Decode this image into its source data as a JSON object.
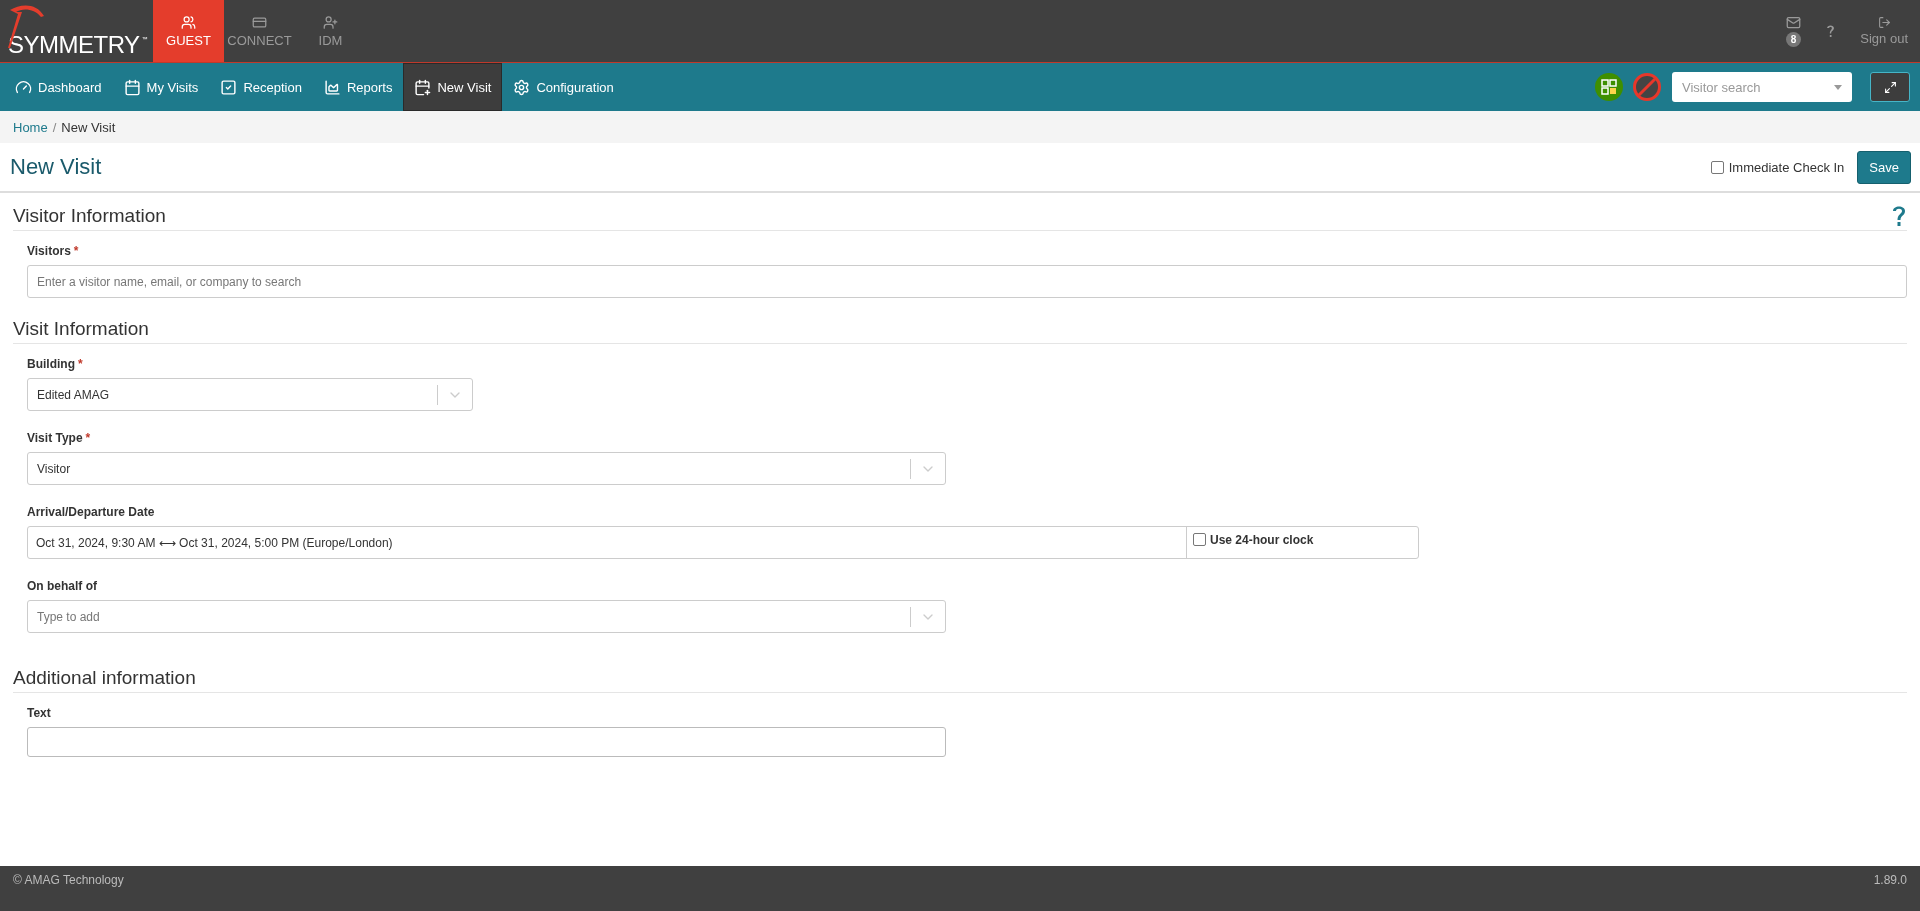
{
  "brand": {
    "name": "SYMMETRY",
    "mark": "™"
  },
  "apps": [
    {
      "label": "GUEST",
      "selected": true
    },
    {
      "label": "CONNECT",
      "selected": false
    },
    {
      "label": "IDM",
      "selected": false
    }
  ],
  "header_right": {
    "messages_badge": "8",
    "sign_out": "Sign out"
  },
  "nav": [
    {
      "label": "Dashboard",
      "selected": false
    },
    {
      "label": "My Visits",
      "selected": false
    },
    {
      "label": "Reception",
      "selected": false
    },
    {
      "label": "Reports",
      "selected": false
    },
    {
      "label": "New Visit",
      "selected": true
    },
    {
      "label": "Configuration",
      "selected": false
    }
  ],
  "visitor_search": {
    "placeholder": "Visitor search"
  },
  "breadcrumb": {
    "items": [
      "Home",
      "New Visit"
    ],
    "separator": "/"
  },
  "page_title": "New Visit",
  "immediate_check_in": {
    "label": "Immediate Check In",
    "checked": false
  },
  "save_button": "Save",
  "sections": [
    {
      "title": "Visitor Information",
      "help": true,
      "fields": [
        {
          "label": "Visitors",
          "required_mark": "*",
          "kind": "search",
          "placeholder": "Enter a visitor name, email, or company to search"
        }
      ]
    },
    {
      "title": "Visit Information",
      "fields": [
        {
          "label": "Building",
          "required_mark": "*",
          "kind": "select",
          "value": "Edited AMAG"
        },
        {
          "label": "Visit Type",
          "required_mark": "*",
          "kind": "select",
          "value": "Visitor"
        },
        {
          "label": "Arrival/Departure Date",
          "kind": "daterange",
          "start": "Oct 31, 2024, 9:30 AM",
          "arrow": "⟷",
          "end": "Oct 31, 2024, 5:00 PM (Europe/London)",
          "clock_label": "Use 24-hour clock",
          "clock_checked": false
        },
        {
          "label": "On behalf of",
          "kind": "select",
          "placeholder": "Type to add"
        }
      ]
    },
    {
      "title": "Additional information",
      "fields": [
        {
          "label": "Text",
          "kind": "text"
        }
      ]
    }
  ],
  "footer": {
    "copyright": "© AMAG Technology",
    "version": "1.89.0"
  }
}
